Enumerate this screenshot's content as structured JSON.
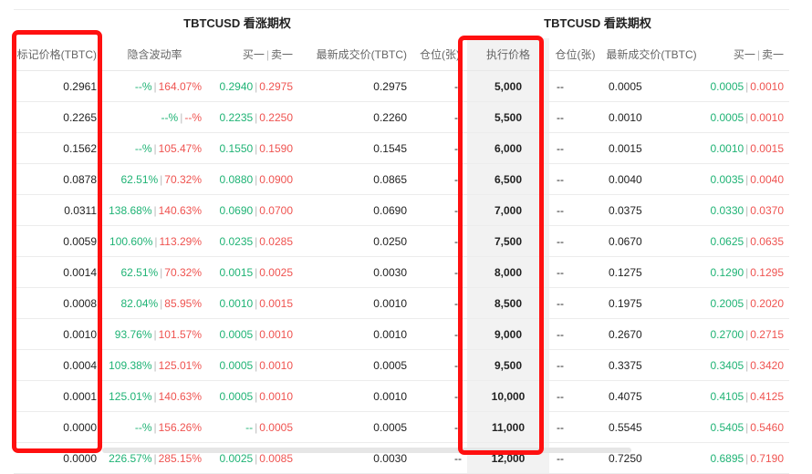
{
  "call_title": "TBTCUSD 看涨期权",
  "put_title": "TBTCUSD 看跌期权",
  "headers": {
    "mark_price": "标记价格(TBTC)",
    "iv": "隐含波动率",
    "bid_ask_left": "买一",
    "bid_ask_sep": "|",
    "bid_ask_right": "卖一",
    "last_price": "最新成交价(TBTC)",
    "position": "仓位(张)",
    "strike": "执行价格",
    "put_position": "仓位(张)",
    "put_last_price": "最新成交价(TBTC)",
    "put_bid_ask_left": "买一",
    "put_bid_ask_right": "卖一"
  },
  "rows": [
    {
      "mark": "0.2961",
      "iv_bid": "--%",
      "iv_ask": "164.07%",
      "bid": "0.2940",
      "ask": "0.2975",
      "last": "0.2975",
      "pos": "--",
      "strike": "5,000",
      "put_pos": "--",
      "put_last": "0.0005",
      "put_bid": "0.0005",
      "put_ask": "0.0010"
    },
    {
      "mark": "0.2265",
      "iv_bid": "--%",
      "iv_ask": "--%",
      "bid": "0.2235",
      "ask": "0.2250",
      "last": "0.2260",
      "pos": "--",
      "strike": "5,500",
      "put_pos": "--",
      "put_last": "0.0010",
      "put_bid": "0.0005",
      "put_ask": "0.0010"
    },
    {
      "mark": "0.1562",
      "iv_bid": "--%",
      "iv_ask": "105.47%",
      "bid": "0.1550",
      "ask": "0.1590",
      "last": "0.1545",
      "pos": "--",
      "strike": "6,000",
      "put_pos": "--",
      "put_last": "0.0015",
      "put_bid": "0.0010",
      "put_ask": "0.0015"
    },
    {
      "mark": "0.0878",
      "iv_bid": "62.51%",
      "iv_ask": "70.32%",
      "bid": "0.0880",
      "ask": "0.0900",
      "last": "0.0865",
      "pos": "--",
      "strike": "6,500",
      "put_pos": "--",
      "put_last": "0.0040",
      "put_bid": "0.0035",
      "put_ask": "0.0040"
    },
    {
      "mark": "0.0311",
      "iv_bid": "138.68%",
      "iv_ask": "140.63%",
      "bid": "0.0690",
      "ask": "0.0700",
      "last": "0.0690",
      "pos": "--",
      "strike": "7,000",
      "put_pos": "--",
      "put_last": "0.0375",
      "put_bid": "0.0330",
      "put_ask": "0.0370"
    },
    {
      "mark": "0.0059",
      "iv_bid": "100.60%",
      "iv_ask": "113.29%",
      "bid": "0.0235",
      "ask": "0.0285",
      "last": "0.0250",
      "pos": "--",
      "strike": "7,500",
      "put_pos": "--",
      "put_last": "0.0670",
      "put_bid": "0.0625",
      "put_ask": "0.0635"
    },
    {
      "mark": "0.0014",
      "iv_bid": "62.51%",
      "iv_ask": "70.32%",
      "bid": "0.0015",
      "ask": "0.0025",
      "last": "0.0030",
      "pos": "--",
      "strike": "8,000",
      "put_pos": "--",
      "put_last": "0.1275",
      "put_bid": "0.1290",
      "put_ask": "0.1295"
    },
    {
      "mark": "0.0008",
      "iv_bid": "82.04%",
      "iv_ask": "85.95%",
      "bid": "0.0010",
      "ask": "0.0015",
      "last": "0.0010",
      "pos": "--",
      "strike": "8,500",
      "put_pos": "--",
      "put_last": "0.1975",
      "put_bid": "0.2005",
      "put_ask": "0.2020"
    },
    {
      "mark": "0.0010",
      "iv_bid": "93.76%",
      "iv_ask": "101.57%",
      "bid": "0.0005",
      "ask": "0.0010",
      "last": "0.0010",
      "pos": "--",
      "strike": "9,000",
      "put_pos": "--",
      "put_last": "0.2670",
      "put_bid": "0.2700",
      "put_ask": "0.2715"
    },
    {
      "mark": "0.0004",
      "iv_bid": "109.38%",
      "iv_ask": "125.01%",
      "bid": "0.0005",
      "ask": "0.0010",
      "last": "0.0005",
      "pos": "--",
      "strike": "9,500",
      "put_pos": "--",
      "put_last": "0.3375",
      "put_bid": "0.3405",
      "put_ask": "0.3420"
    },
    {
      "mark": "0.0001",
      "iv_bid": "125.01%",
      "iv_ask": "140.63%",
      "bid": "0.0005",
      "ask": "0.0010",
      "last": "0.0010",
      "pos": "--",
      "strike": "10,000",
      "put_pos": "--",
      "put_last": "0.4075",
      "put_bid": "0.4105",
      "put_ask": "0.4125"
    },
    {
      "mark": "0.0000",
      "iv_bid": "--%",
      "iv_ask": "156.26%",
      "bid": "--",
      "ask": "0.0005",
      "last": "0.0005",
      "pos": "--",
      "strike": "11,000",
      "put_pos": "--",
      "put_last": "0.5545",
      "put_bid": "0.5405",
      "put_ask": "0.5460"
    },
    {
      "mark": "0.0000",
      "iv_bid": "226.57%",
      "iv_ask": "285.15%",
      "bid": "0.0025",
      "ask": "0.0085",
      "last": "0.0030",
      "pos": "--",
      "strike": "12,000",
      "put_pos": "--",
      "put_last": "0.7250",
      "put_bid": "0.6895",
      "put_ask": "0.7190"
    }
  ],
  "colors": {
    "bid": "#1fb375",
    "ask": "#ef5350",
    "highlight": "#ff1010",
    "strike_bg": "#f2f2f2"
  }
}
